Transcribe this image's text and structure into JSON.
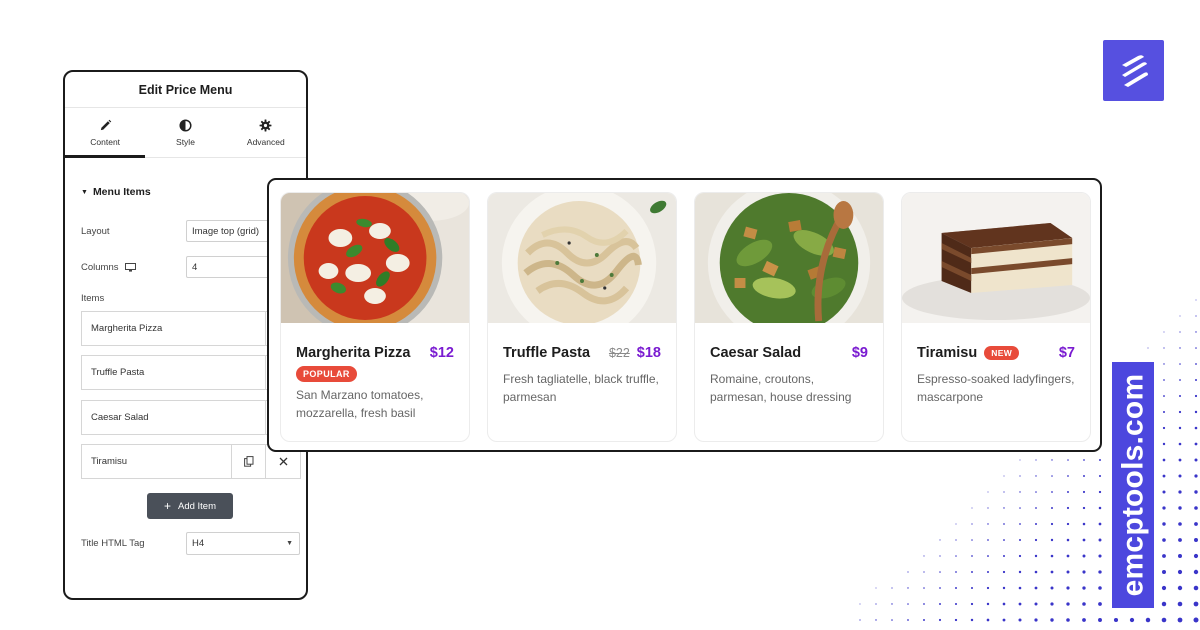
{
  "brand": {
    "site": "emcptools.com",
    "accent": "#4c47de"
  },
  "editor": {
    "title": "Edit Price Menu",
    "tabs": [
      {
        "label": "Content",
        "icon": "pencil-icon",
        "active": true
      },
      {
        "label": "Style",
        "icon": "contrast-icon",
        "active": false
      },
      {
        "label": "Advanced",
        "icon": "gear-icon",
        "active": false
      }
    ],
    "section": "Menu Items",
    "layout_label": "Layout",
    "layout_value": "Image top (grid)",
    "columns_label": "Columns",
    "columns_value": "4",
    "items_label": "Items",
    "items": [
      "Margherita Pizza",
      "Truffle Pasta",
      "Caesar Salad",
      "Tiramisu"
    ],
    "add_item": "Add Item",
    "title_tag_label": "Title HTML Tag",
    "title_tag_value": "H4"
  },
  "menu": [
    {
      "name": "Margherita Pizza",
      "price": "$12",
      "old_price": "",
      "badge": "POPULAR",
      "desc": "San Marzano tomatoes, mozzarella, fresh basil",
      "photo": "pizza"
    },
    {
      "name": "Truffle Pasta",
      "price": "$18",
      "old_price": "$22",
      "badge": "",
      "desc": "Fresh tagliatelle, black truffle, parmesan",
      "photo": "pasta"
    },
    {
      "name": "Caesar Salad",
      "price": "$9",
      "old_price": "",
      "badge": "",
      "desc": "Romaine, croutons, parmesan, house dressing",
      "photo": "salad"
    },
    {
      "name": "Tiramisu",
      "price": "$7",
      "old_price": "",
      "badge": "NEW",
      "desc": "Espresso-soaked ladyfingers, mascarpone",
      "photo": "tiramisu"
    }
  ],
  "colors": {
    "price": "#7a1bd1",
    "badge": "#e84b3a",
    "button": "#4a5059"
  }
}
